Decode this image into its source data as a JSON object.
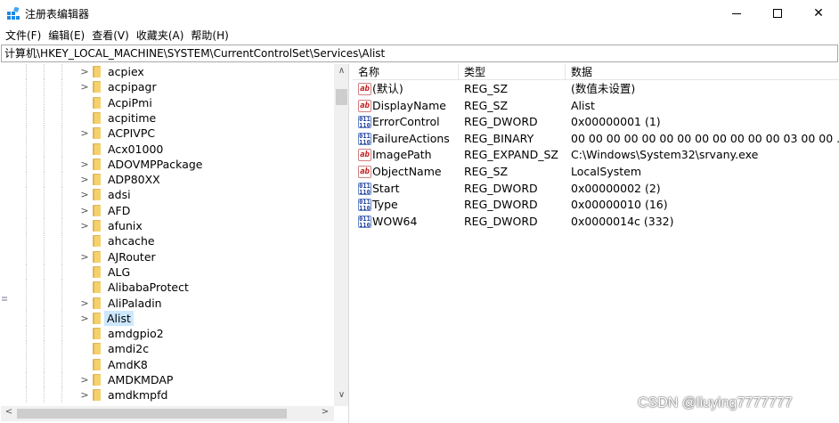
{
  "window": {
    "title": "注册表编辑器",
    "minimize_glyph": "",
    "maximize_glyph": "",
    "close_glyph": "✕"
  },
  "menu": [
    {
      "label": "文件(F)"
    },
    {
      "label": "编辑(E)"
    },
    {
      "label": "查看(V)"
    },
    {
      "label": "收藏夹(A)"
    },
    {
      "label": "帮助(H)"
    }
  ],
  "address": "计算机\\HKEY_LOCAL_MACHINE\\SYSTEM\\CurrentControlSet\\Services\\Alist",
  "tree": {
    "items": [
      {
        "label": "acpiex",
        "expandable": true
      },
      {
        "label": "acpipagr",
        "expandable": true
      },
      {
        "label": "AcpiPmi",
        "expandable": false
      },
      {
        "label": "acpitime",
        "expandable": false
      },
      {
        "label": "ACPIVPC",
        "expandable": true
      },
      {
        "label": "Acx01000",
        "expandable": false
      },
      {
        "label": "ADOVMPPackage",
        "expandable": true
      },
      {
        "label": "ADP80XX",
        "expandable": true
      },
      {
        "label": "adsi",
        "expandable": true
      },
      {
        "label": "AFD",
        "expandable": true
      },
      {
        "label": "afunix",
        "expandable": true
      },
      {
        "label": "ahcache",
        "expandable": false
      },
      {
        "label": "AJRouter",
        "expandable": true
      },
      {
        "label": "ALG",
        "expandable": false
      },
      {
        "label": "AlibabaProtect",
        "expandable": false
      },
      {
        "label": "AliPaladin",
        "expandable": true
      },
      {
        "label": "Alist",
        "expandable": true,
        "selected": true
      },
      {
        "label": "amdgpio2",
        "expandable": false
      },
      {
        "label": "amdi2c",
        "expandable": false
      },
      {
        "label": "AmdK8",
        "expandable": false
      },
      {
        "label": "AMDKMDAP",
        "expandable": true
      },
      {
        "label": "amdkmpfd",
        "expandable": true
      }
    ],
    "scroll_up_glyph": "∧",
    "scroll_down_glyph": "∨",
    "scroll_left_glyph": "<",
    "scroll_right_glyph": ">"
  },
  "values": {
    "headers": {
      "name": "名称",
      "type": "类型",
      "data": "数据"
    },
    "rows": [
      {
        "icon": "string-value-icon",
        "icon_text": "ab",
        "name": "(默认)",
        "type": "REG_SZ",
        "data": "(数值未设置)"
      },
      {
        "icon": "string-value-icon",
        "icon_text": "ab",
        "name": "DisplayName",
        "type": "REG_SZ",
        "data": "Alist"
      },
      {
        "icon": "binary-value-icon",
        "icon_text": "011\n110",
        "name": "ErrorControl",
        "type": "REG_DWORD",
        "data": "0x00000001 (1)"
      },
      {
        "icon": "binary-value-icon",
        "icon_text": "011\n110",
        "name": "FailureActions",
        "type": "REG_BINARY",
        "data": "00 00 00 00 00 00 00 00 00 00 00 00 03 00 00 ..."
      },
      {
        "icon": "string-value-icon",
        "icon_text": "ab",
        "name": "ImagePath",
        "type": "REG_EXPAND_SZ",
        "data": "C:\\Windows\\System32\\srvany.exe"
      },
      {
        "icon": "string-value-icon",
        "icon_text": "ab",
        "name": "ObjectName",
        "type": "REG_SZ",
        "data": "LocalSystem"
      },
      {
        "icon": "binary-value-icon",
        "icon_text": "011\n110",
        "name": "Start",
        "type": "REG_DWORD",
        "data": "0x00000002 (2)"
      },
      {
        "icon": "binary-value-icon",
        "icon_text": "011\n110",
        "name": "Type",
        "type": "REG_DWORD",
        "data": "0x00000010 (16)"
      },
      {
        "icon": "binary-value-icon",
        "icon_text": "011\n110",
        "name": "WOW64",
        "type": "REG_DWORD",
        "data": "0x0000014c (332)"
      }
    ]
  },
  "watermark": "CSDN @liuying7777777",
  "colors": {
    "selection": "#cce8ff",
    "folder": "#f6d16b"
  }
}
